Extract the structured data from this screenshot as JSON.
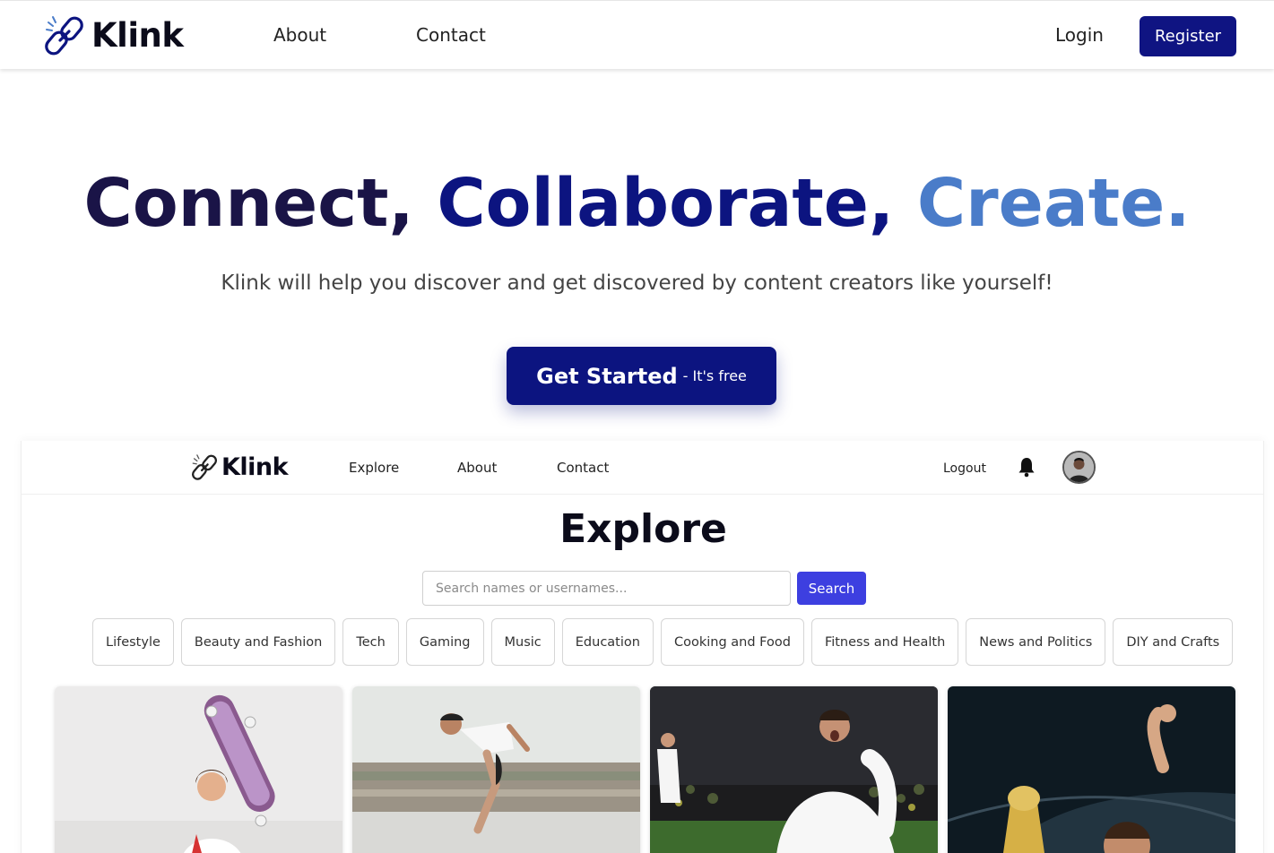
{
  "topnav": {
    "brand": "Klink",
    "links": [
      "About",
      "Contact"
    ],
    "login": "Login",
    "register": "Register",
    "logo_icon": "chain-link-icon"
  },
  "hero": {
    "title_words": [
      "Connect,",
      "Collaborate,",
      "Create."
    ],
    "title_colors": [
      "#1a1447",
      "#0c1480",
      "#4a7cc9"
    ],
    "subtitle": "Klink will help you discover and get discovered by content creators like yourself!",
    "cta_main": "Get Started",
    "cta_small": "- It's free"
  },
  "preview": {
    "brand": "Klink",
    "links": [
      "Explore",
      "About",
      "Contact"
    ],
    "logout": "Logout",
    "bell_icon": "bell-icon",
    "avatar_icon": "user-avatar",
    "title": "Explore",
    "search": {
      "placeholder": "Search names or usernames...",
      "button": "Search"
    },
    "categories": [
      "Lifestyle",
      "Beauty and Fashion",
      "Tech",
      "Gaming",
      "Music",
      "Education",
      "Cooking and Food",
      "Fitness and Health",
      "News and Politics",
      "DIY and Crafts"
    ]
  },
  "colors": {
    "primary": "#0c1480",
    "search_button": "#3d3fe0"
  }
}
